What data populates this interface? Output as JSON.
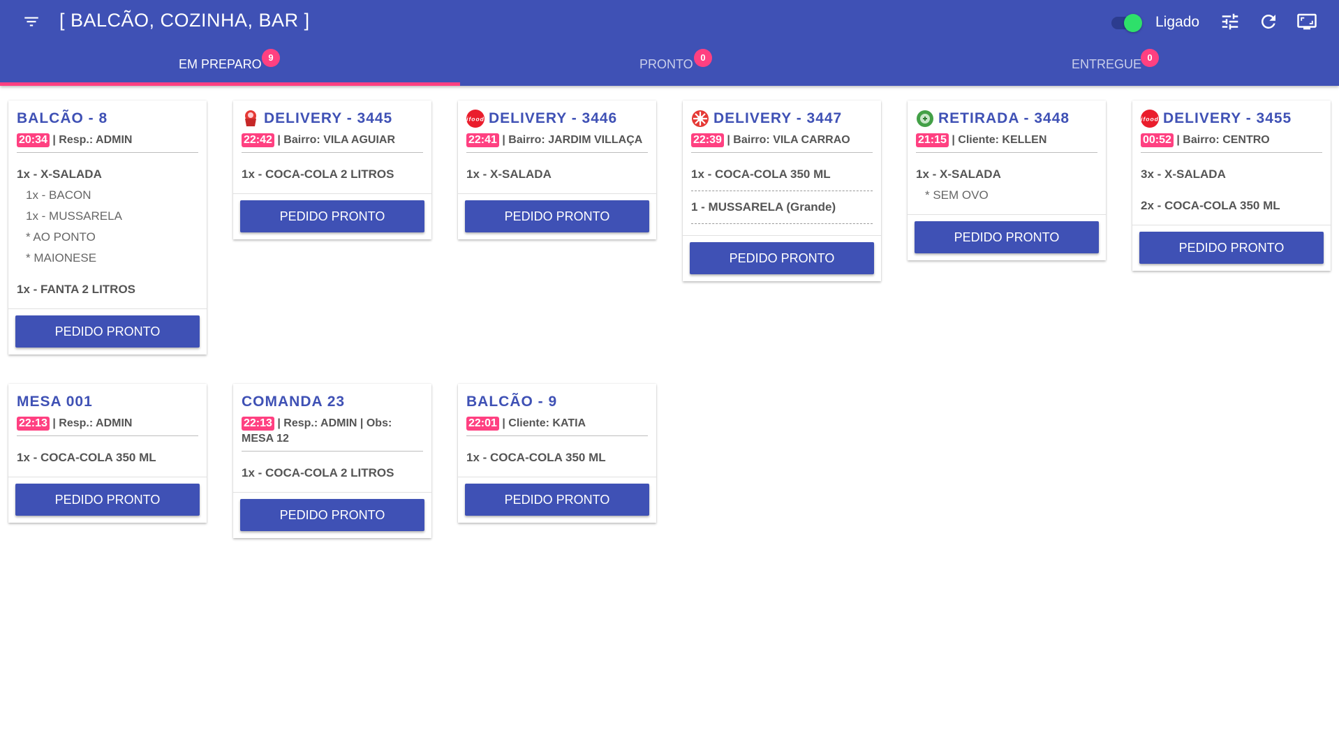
{
  "header": {
    "title": "[ BALCÃO, COZINHA, BAR ]",
    "toggle_label": "Ligado",
    "toggle_on": true,
    "icons": [
      "filter-menu-icon",
      "tune-icon",
      "refresh-icon",
      "fullscreen-icon"
    ]
  },
  "tabs": [
    {
      "label": "EM PREPARO",
      "badge": "9",
      "active": true
    },
    {
      "label": "PRONTO",
      "badge": "0",
      "active": false
    },
    {
      "label": "ENTREGUE",
      "badge": "0",
      "active": false
    }
  ],
  "colors": {
    "primary": "#3f51b5",
    "accent": "#ff4081",
    "toggle": "#2ee06a"
  },
  "button_label": "PEDIDO PRONTO",
  "cards": [
    {
      "title": "BALCÃO - 8",
      "icon": null,
      "time": "20:34",
      "info": " | Resp.: ADMIN",
      "items": [
        {
          "text": "1x - X-SALADA",
          "subs": [
            "1x - BACON",
            "1x - MUSSARELA",
            "* AO PONTO",
            "* MAIONESE"
          ]
        },
        {
          "text": "1x - FANTA 2 LITROS",
          "subs": []
        }
      ]
    },
    {
      "title": "DELIVERY - 3445",
      "icon": "delivery-bag-icon",
      "time": "22:42",
      "info": " | Bairro: VILA AGUIAR",
      "items": [
        {
          "text": "1x - COCA-COLA 2 LITROS",
          "subs": []
        }
      ]
    },
    {
      "title": "DELIVERY - 3446",
      "icon": "ifood-icon",
      "time": "22:41",
      "info": " | Bairro: JARDIM VILLAÇA",
      "items": [
        {
          "text": "1x - X-SALADA",
          "subs": []
        }
      ]
    },
    {
      "title": "DELIVERY - 3447",
      "icon": "delivery-app-icon",
      "time": "22:39",
      "info": " | Bairro: VILA CARRAO",
      "items": [
        {
          "text": "1x - COCA-COLA 350 ML",
          "subs": [],
          "sep": true
        },
        {
          "text": "1 - MUSSARELA (Grande)",
          "subs": [],
          "sep": true
        }
      ]
    },
    {
      "title": "RETIRADA - 3448",
      "icon": "pickup-icon",
      "time": "21:15",
      "info": " | Cliente: KELLEN",
      "items": [
        {
          "text": "1x - X-SALADA",
          "subs": [
            "* SEM OVO"
          ]
        }
      ]
    },
    {
      "title": "DELIVERY - 3455",
      "icon": "ifood-icon",
      "time": "00:52",
      "info": " | Bairro: CENTRO",
      "items": [
        {
          "text": "3x - X-SALADA",
          "subs": []
        },
        {
          "text": "2x - COCA-COLA 350 ML",
          "subs": []
        }
      ]
    },
    {
      "title": "MESA 001",
      "icon": null,
      "time": "22:13",
      "info": " | Resp.: ADMIN",
      "items": [
        {
          "text": "1x - COCA-COLA 350 ML",
          "subs": []
        }
      ]
    },
    {
      "title": "COMANDA 23",
      "icon": null,
      "time": "22:13",
      "info": " | Resp.: ADMIN | Obs: MESA 12",
      "items": [
        {
          "text": "1x - COCA-COLA 2 LITROS",
          "subs": []
        }
      ]
    },
    {
      "title": "BALCÃO - 9",
      "icon": null,
      "time": "22:01",
      "info": " | Cliente: KATIA",
      "items": [
        {
          "text": "1x - COCA-COLA 350 ML",
          "subs": []
        }
      ]
    }
  ]
}
